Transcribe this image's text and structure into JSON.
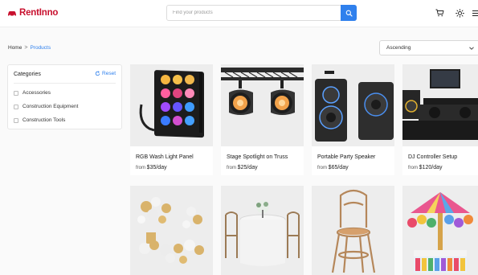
{
  "header": {
    "brand": "RentInno",
    "search_placeholder": "Find your products"
  },
  "breadcrumb": {
    "home": "Home",
    "separator": ">",
    "current": "Products"
  },
  "sort": {
    "selected": "Ascending"
  },
  "categories": {
    "title": "Categories",
    "reset_label": "Reset",
    "items": [
      "Accessories",
      "Construction Equipment",
      "Construction Tools"
    ]
  },
  "products": [
    {
      "name": "RGB Wash Light Panel",
      "price_prefix": "from",
      "price": "$35/day"
    },
    {
      "name": "Stage Spotlight on Truss",
      "price_prefix": "from",
      "price": "$25/day"
    },
    {
      "name": "Portable Party Speaker",
      "price_prefix": "from",
      "price": "$65/day"
    },
    {
      "name": "DJ Controller Setup",
      "price_prefix": "from",
      "price": "$120/day"
    }
  ],
  "colors": {
    "brand": "#c8102e",
    "accent": "#2f80ed",
    "card_image_bg": "#ededed"
  },
  "icons": {
    "search_button": "search-icon",
    "cart": "cart-icon",
    "theme": "sun-icon",
    "menu": "menu-icon",
    "reset": "refresh-icon",
    "sort": "chevron-down-icon"
  }
}
